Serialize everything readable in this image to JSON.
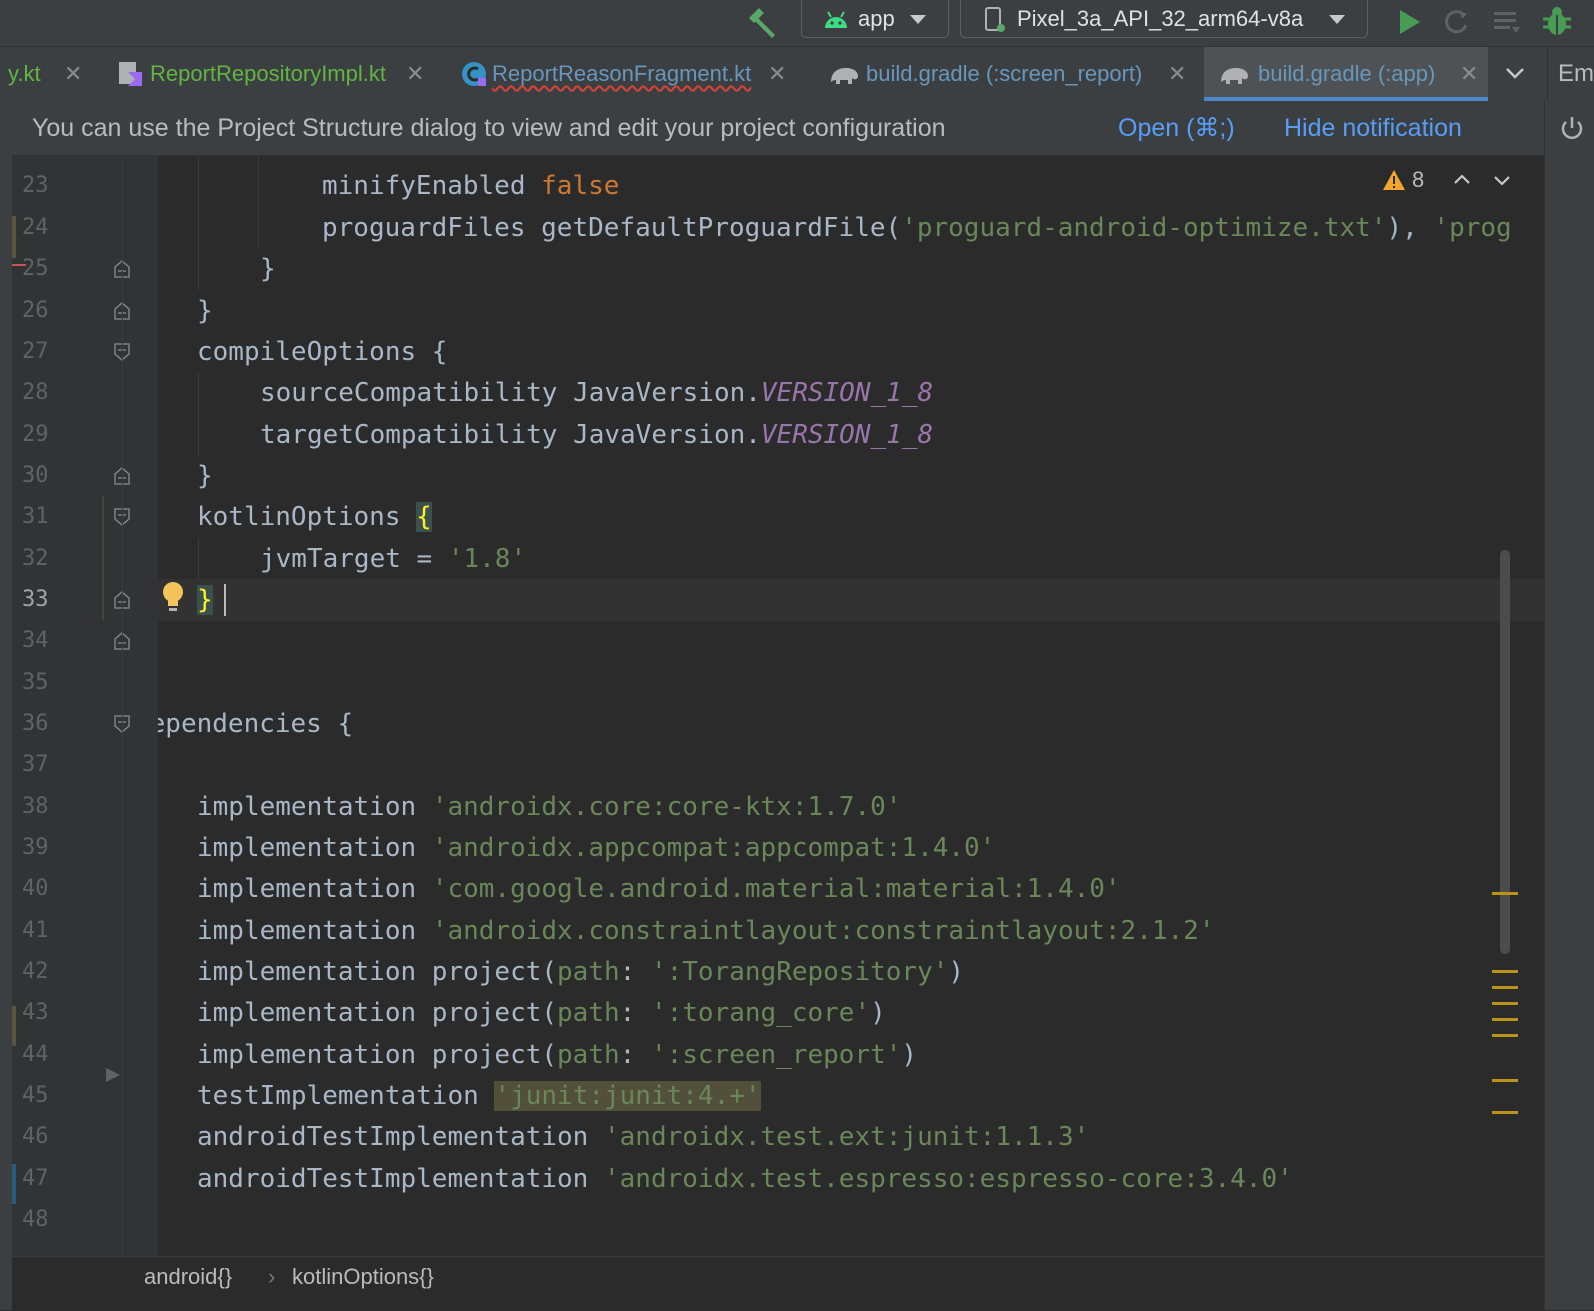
{
  "toolbar": {
    "run_config": "app",
    "device": "Pixel_3a_API_32_arm64-v8a"
  },
  "tabs": [
    {
      "label": "y.kt",
      "type": "kotlin"
    },
    {
      "label": "ReportRepositoryImpl.kt",
      "type": "kotlin"
    },
    {
      "label": "ReportReasonFragment.kt",
      "type": "kotlin-class"
    },
    {
      "label": "build.gradle (:screen_report)",
      "type": "gradle"
    },
    {
      "label": "build.gradle (:app)",
      "type": "gradle",
      "active": true
    }
  ],
  "side_tool": "Em",
  "notification": {
    "text": "You can use the Project Structure dialog to view and edit your project configuration",
    "open_link": "Open (⌘;)",
    "hide_link": "Hide notification"
  },
  "editor": {
    "warning_count": "8",
    "current_line": "33",
    "line_numbers": [
      "23",
      "24",
      "25",
      "26",
      "27",
      "28",
      "29",
      "30",
      "31",
      "32",
      "33",
      "34",
      "35",
      "36",
      "37",
      "38",
      "39",
      "40",
      "41",
      "42",
      "43",
      "44",
      "45",
      "46",
      "47",
      "48"
    ],
    "lines": {
      "l23": {
        "a": "minifyEnabled ",
        "b": "false"
      },
      "l24": {
        "a": "proguardFiles getDefaultProguardFile(",
        "b": "'proguard-android-optimize.txt'",
        "c": "), ",
        "d": "'prog"
      },
      "l25": "}",
      "l26": "}",
      "l27": "compileOptions {",
      "l28": {
        "a": "sourceCompatibility JavaVersion.",
        "b": "VERSION_1_8"
      },
      "l29": {
        "a": "targetCompatibility JavaVersion.",
        "b": "VERSION_1_8"
      },
      "l30": "}",
      "l31": {
        "a": "kotlinOptions ",
        "b": "{"
      },
      "l32": {
        "a": "jvmTarget = ",
        "b": "'1.8'"
      },
      "l33": "}",
      "l34": "}",
      "l36": "dependencies {",
      "l38": {
        "a": "implementation ",
        "b": "'androidx.core:core-ktx:1.7.0'"
      },
      "l39": {
        "a": "implementation ",
        "b": "'androidx.appcompat:appcompat:1.4.0'"
      },
      "l40": {
        "a": "implementation ",
        "b": "'com.google.android.material:material:1.4.0'"
      },
      "l41": {
        "a": "implementation ",
        "b": "'androidx.constraintlayout:constraintlayout:2.1.2'"
      },
      "l42": {
        "a": "implementation project(",
        "p": "path",
        "c": ": ",
        "b": "':TorangRepository'",
        "d": ")"
      },
      "l43": {
        "a": "implementation project(",
        "p": "path",
        "c": ": ",
        "b": "':torang_core'",
        "d": ")"
      },
      "l44": {
        "a": "implementation project(",
        "p": "path",
        "c": ": ",
        "b": "':screen_report'",
        "d": ")"
      },
      "l45": {
        "a": "testImplementation ",
        "b": "'junit:junit:4.+'"
      },
      "l46": {
        "a": "androidTestImplementation ",
        "b": "'androidx.test.ext:junit:1.1.3'"
      },
      "l47": {
        "a": "androidTestImplementation ",
        "b": "'androidx.test.espresso:espresso-core:3.4.0'"
      }
    }
  },
  "breadcrumbs": [
    "android{}",
    "›",
    "kotlinOptions{}"
  ],
  "colors": {
    "background": "#2b2b2b",
    "keyword": "#cc7832",
    "string": "#6a8759",
    "constant": "#9876aa",
    "link": "#589df6",
    "active_tab_underline": "#4a88c7",
    "kotlin_file": "#62b543"
  }
}
